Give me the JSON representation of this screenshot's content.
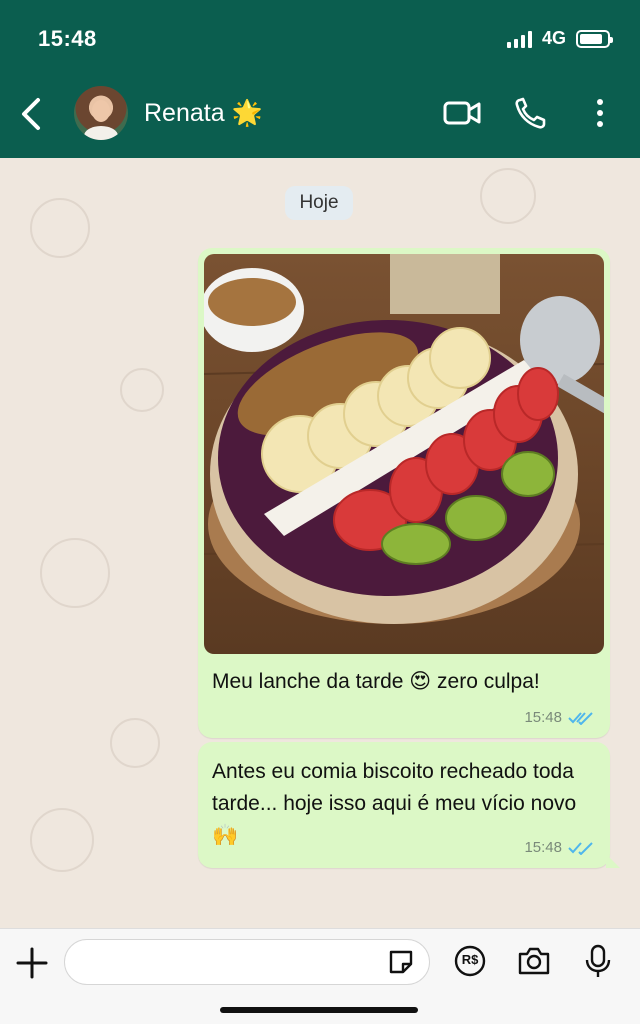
{
  "status_bar": {
    "time": "15:48",
    "network": "4G",
    "battery_percent": 85
  },
  "header": {
    "contact_name": "Renata 🌟",
    "icons": [
      "back-arrow-icon",
      "video-call-icon",
      "phone-icon",
      "more-vertical-icon"
    ]
  },
  "chat": {
    "date_label": "Hoje",
    "messages": [
      {
        "type": "image",
        "image_icon": "acai-bowl-photo",
        "text": "Meu lanche da tarde 😍 zero culpa!",
        "time": "15:48",
        "status": "read"
      },
      {
        "type": "text",
        "text": "Antes eu comia biscoito recheado toda tarde... hoje isso aqui é meu vício novo 🙌",
        "time": "15:48",
        "status": "read"
      }
    ]
  },
  "composer": {
    "input_value": "",
    "input_placeholder": "",
    "icons": [
      "plus-icon",
      "sticker-icon",
      "pix-payment-icon",
      "camera-icon",
      "microphone-icon"
    ],
    "pay_label": "R$"
  },
  "colors": {
    "header": "#0b5e4f",
    "bubble_out": "#dcf8c6",
    "chat_bg": "#efe7de",
    "read_ticks": "#4fb6ec"
  }
}
